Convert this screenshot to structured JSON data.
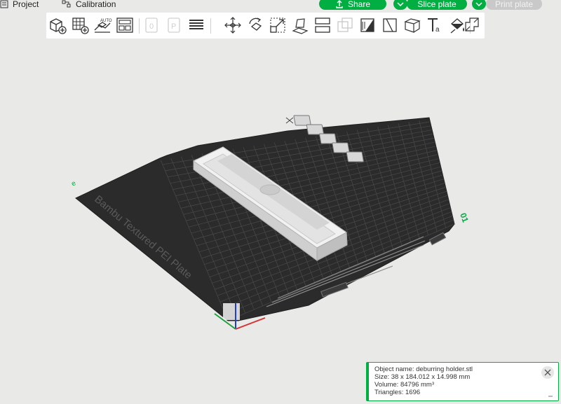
{
  "header": {
    "project_label": "Project",
    "calibration_label": "Calibration",
    "share_label": "Share",
    "slice_label": "Slice plate",
    "print_label": "Print plate",
    "icons": [
      "project-icon",
      "calibration-icon",
      "share-icon",
      "chevron-down-icon"
    ]
  },
  "toolbar": {
    "tools": [
      {
        "name": "add-object-icon"
      },
      {
        "name": "add-plate-icon"
      },
      {
        "name": "auto-arrange-icon",
        "text": "AUTO"
      },
      {
        "name": "arrange-icon"
      },
      {
        "name": "plate-number-icon",
        "text": "0"
      },
      {
        "name": "plate-settings-icon",
        "text": "P"
      },
      {
        "name": "layers-icon"
      },
      {
        "name": "move-icon"
      },
      {
        "name": "rotate-icon"
      },
      {
        "name": "scale-icon"
      },
      {
        "name": "lay-on-face-icon"
      },
      {
        "name": "cut-icon"
      },
      {
        "name": "boolean-icon"
      },
      {
        "name": "support-paint-icon"
      },
      {
        "name": "seam-paint-icon"
      },
      {
        "name": "emboss-icon"
      },
      {
        "name": "text-icon",
        "text": "Ta"
      },
      {
        "name": "color-paint-icon"
      },
      {
        "name": "assembly-icon"
      }
    ]
  },
  "plate": {
    "label": "Bambu Textured PEI Plate",
    "plate_number": "01",
    "grid_color": "#3a3a3a",
    "bed_color": "#2b2b2b",
    "accent": "#00ae42"
  },
  "object_info": {
    "name_line": "Object name: deburring holder.stl",
    "size_line": "Size: 38 x 184.012 x 14.998 mm",
    "volume_line": "Volume: 84796 mm³",
    "triangles_line": "Triangles: 1696"
  }
}
